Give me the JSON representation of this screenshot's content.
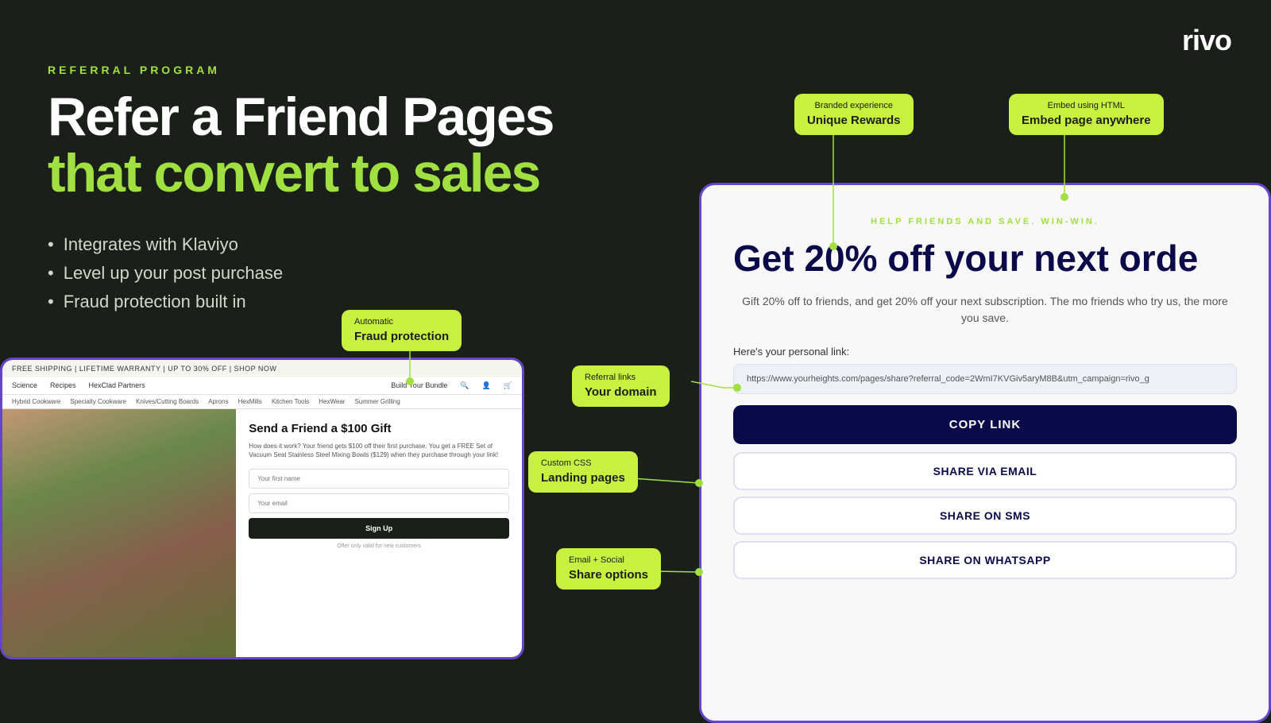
{
  "logo": {
    "text": "rivo"
  },
  "header": {
    "referral_label": "REFERRAL  PROGRAM",
    "headline_line1": "Refer a Friend Pages",
    "headline_line2": "that convert to sales"
  },
  "bullets": [
    "Integrates with Klaviyo",
    "Level up your post purchase",
    "Fraud protection built in"
  ],
  "badges": {
    "branded": {
      "top": "Branded experience",
      "bottom": "Unique Rewards"
    },
    "embed": {
      "top": "Embed using HTML",
      "bottom": "Embed page anywhere"
    },
    "fraud": {
      "top": "Automatic",
      "bottom": "Fraud protection"
    },
    "referral": {
      "top": "Referral links",
      "bottom": "Your domain"
    },
    "css": {
      "top": "Custom CSS",
      "bottom": "Landing pages"
    },
    "email": {
      "top": "Email + Social",
      "bottom": "Share options"
    }
  },
  "browser": {
    "topbar": "FREE SHIPPING | LIFETIME WARRANTY | UP TO 30% OFF | SHOP NOW",
    "nav_items": [
      "Science",
      "Recipes",
      "HexClad Partners",
      "Build Your Bundle"
    ],
    "subnav_items": [
      "Hybrid Cookware",
      "Specialty Cookware",
      "Knives/Cutting Boards",
      "Aprons",
      "HexMills",
      "Kitchen Tools",
      "HexWear",
      "Summer Grilling"
    ],
    "form_title": "Send a Friend a $100 Gift",
    "form_desc": "How does it work? Your friend gets $100 off their first purchase. You get a FREE Set of Vacuum Seal Stainless Steel Mixing Bowls ($129) when they purchase through your link!",
    "input1_placeholder": "Your first name",
    "input2_placeholder": "Your email",
    "btn_label": "Sign Up",
    "note": "Offer only valid for new customers"
  },
  "panel": {
    "label": "HELP FRIENDS AND SAVE. WIN-WIN.",
    "headline": "Get 20% off your next orde",
    "subtext": "Gift 20% off to friends, and get 20% off your next subscription. The mo friends who try us, the more you save.",
    "link_label": "Here's your personal link:",
    "link_value": "https://www.yourheights.com/pages/share?referral_code=2WmI7KVGiv5aryM8B&utm_campaign=rivo_g",
    "copy_btn": "COPY LINK",
    "share_email_btn": "SHARE VIA EMAIL",
    "share_sms_btn": "SHARE ON SMS",
    "share_whatsapp_btn": "SHARE ON WHATSAPP"
  }
}
